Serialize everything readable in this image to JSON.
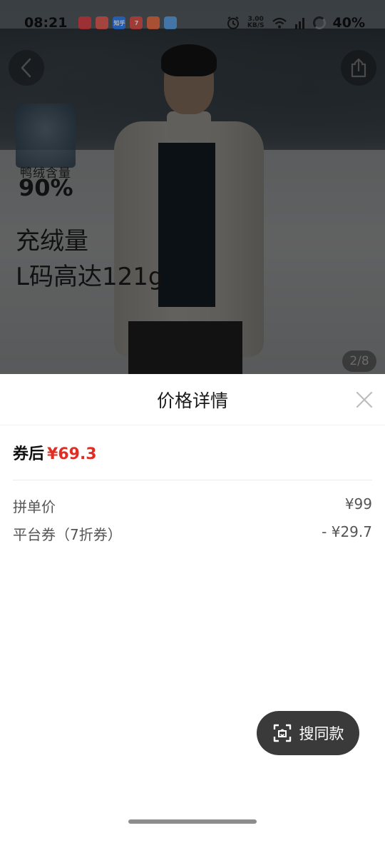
{
  "status_bar": {
    "time": "08:21",
    "speed_value": "3.00",
    "speed_unit": "KB/S",
    "battery": "40%",
    "notification_icons": [
      {
        "name": "app-notification-icon",
        "color": "#e0262b",
        "label": ""
      },
      {
        "name": "app-notification-icon",
        "color": "#e9473b",
        "label": ""
      },
      {
        "name": "zhihu-icon",
        "color": "#1772f6",
        "label": "知乎"
      },
      {
        "name": "app-notification-icon",
        "color": "#e43a2f",
        "label": "7"
      },
      {
        "name": "app-notification-icon",
        "color": "#f15b2a",
        "label": ""
      },
      {
        "name": "weather-icon",
        "color": "#4a9be8",
        "label": ""
      }
    ]
  },
  "product_image": {
    "badge_text": "鸭绒含量",
    "badge_percent": "90%",
    "headline_line1": "充绒量",
    "headline_line2": "L码高达121g",
    "page_indicator": "2/8"
  },
  "price_sheet": {
    "title": "价格详情",
    "after_coupon_label": "券后",
    "after_coupon_price": "¥69.3",
    "rows": [
      {
        "label": "拼单价",
        "value": "¥99"
      },
      {
        "label": "平台券（7折券）",
        "value": "- ¥29.7"
      }
    ]
  },
  "search_similar": {
    "label": "搜同款"
  },
  "colors": {
    "price_red": "#e02e24",
    "floating_button_bg": "#3a3a3a"
  }
}
